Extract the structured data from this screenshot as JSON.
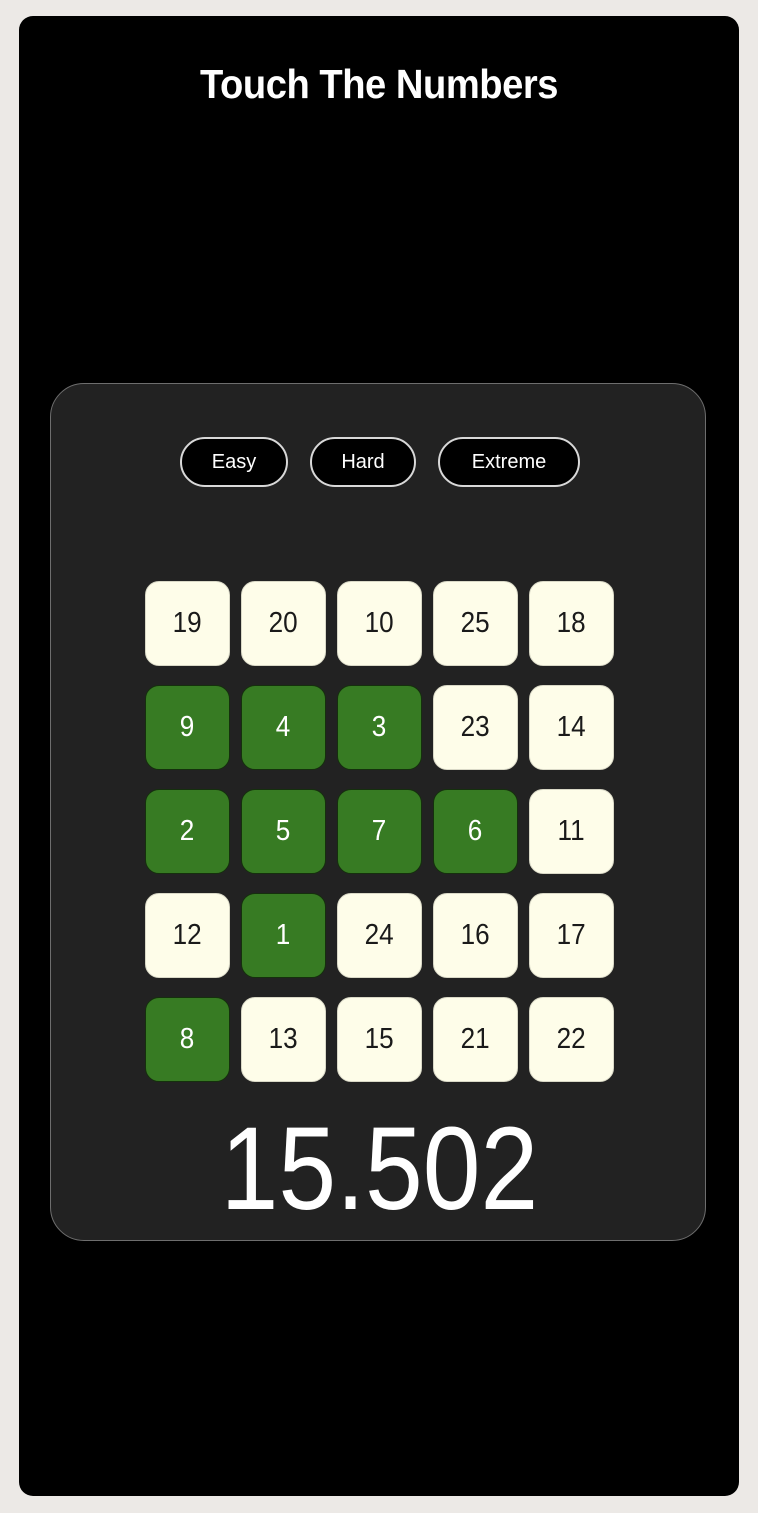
{
  "app": {
    "title": "Touch The Numbers"
  },
  "modes": [
    {
      "label": "Easy"
    },
    {
      "label": "Hard"
    },
    {
      "label": "Extreme"
    }
  ],
  "board": {
    "tiles": [
      {
        "value": "19",
        "state": "fresh"
      },
      {
        "value": "20",
        "state": "fresh"
      },
      {
        "value": "10",
        "state": "fresh"
      },
      {
        "value": "25",
        "state": "fresh"
      },
      {
        "value": "18",
        "state": "fresh"
      },
      {
        "value": "9",
        "state": "done"
      },
      {
        "value": "4",
        "state": "done"
      },
      {
        "value": "3",
        "state": "done"
      },
      {
        "value": "23",
        "state": "fresh"
      },
      {
        "value": "14",
        "state": "fresh"
      },
      {
        "value": "2",
        "state": "done"
      },
      {
        "value": "5",
        "state": "done"
      },
      {
        "value": "7",
        "state": "done"
      },
      {
        "value": "6",
        "state": "done"
      },
      {
        "value": "11",
        "state": "fresh"
      },
      {
        "value": "12",
        "state": "fresh"
      },
      {
        "value": "1",
        "state": "done"
      },
      {
        "value": "24",
        "state": "fresh"
      },
      {
        "value": "16",
        "state": "fresh"
      },
      {
        "value": "17",
        "state": "fresh"
      },
      {
        "value": "8",
        "state": "done"
      },
      {
        "value": "13",
        "state": "fresh"
      },
      {
        "value": "15",
        "state": "fresh"
      },
      {
        "value": "21",
        "state": "fresh"
      },
      {
        "value": "22",
        "state": "fresh"
      }
    ]
  },
  "timer": {
    "value": "15.502"
  },
  "colors": {
    "background": "#000000",
    "panel": "#222222",
    "tile_fresh": "#fefde9",
    "tile_done": "#377b23",
    "text": "#ffffff"
  }
}
